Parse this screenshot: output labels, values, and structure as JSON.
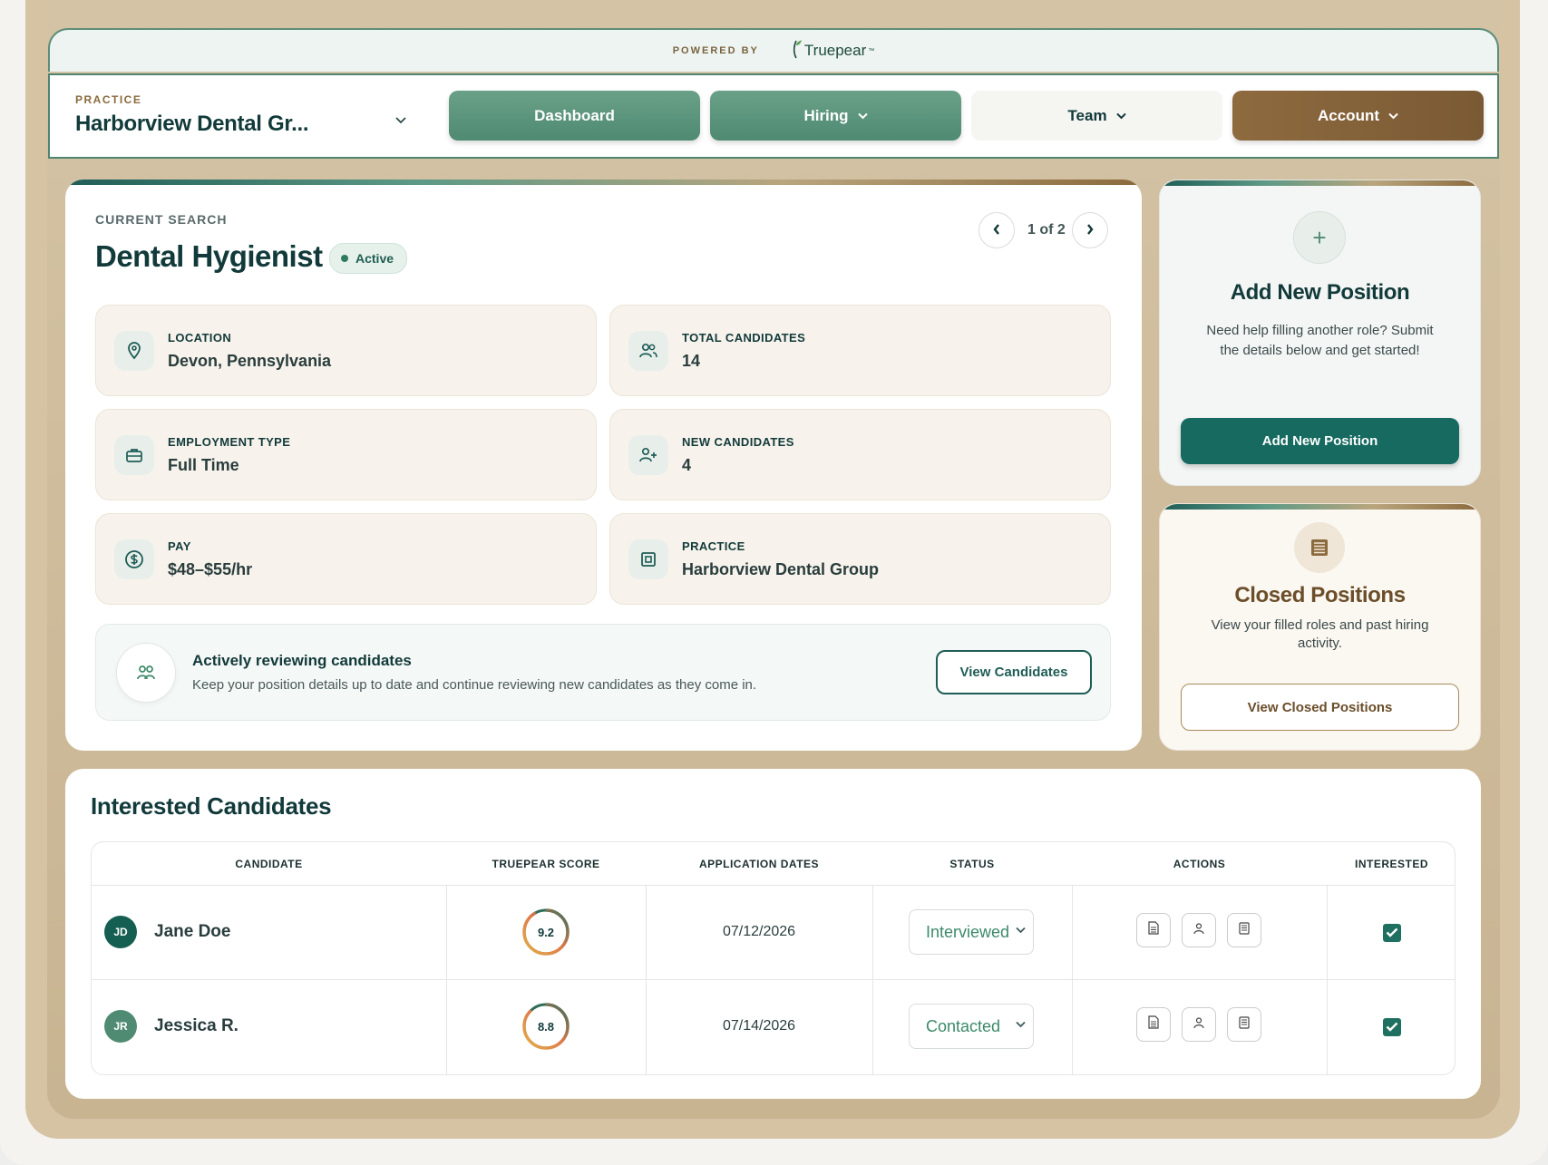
{
  "brand": {
    "powered_by": "POWERED BY",
    "name": "Truepear",
    "tm": "™"
  },
  "nav": {
    "practice_label": "PRACTICE",
    "practice_name": "Harborview Dental Gr...",
    "dashboard": "Dashboard",
    "hiring": "Hiring",
    "team": "Team",
    "account": "Account"
  },
  "search": {
    "label": "CURRENT SEARCH",
    "title": "Dental Hygienist",
    "status": "Active",
    "pager": "1 of 2",
    "tiles": [
      {
        "label": "LOCATION",
        "value": "Devon, Pennsylvania",
        "icon": "map-pin-icon"
      },
      {
        "label": "TOTAL CANDIDATES",
        "value": "14",
        "icon": "users-icon"
      },
      {
        "label": "EMPLOYMENT TYPE",
        "value": "Full Time",
        "icon": "briefcase-icon"
      },
      {
        "label": "NEW CANDIDATES",
        "value": "4",
        "icon": "user-plus-icon"
      },
      {
        "label": "PAY",
        "value": "$48–$55/hr",
        "icon": "dollar-icon"
      },
      {
        "label": "PRACTICE",
        "value": "Harborview Dental Group",
        "icon": "building-icon"
      }
    ],
    "review_title": "Actively reviewing candidates",
    "review_desc": "Keep your position details up to date and continue reviewing new candidates as they come in.",
    "view_candidates": "View Candidates"
  },
  "add_position": {
    "icon": "+",
    "title": "Add New Position",
    "desc": "Need help filling another role? Submit the details below and get started!",
    "button": "Add New Position"
  },
  "closed_positions": {
    "title": "Closed Positions",
    "desc": "View your filled roles and past hiring activity.",
    "button": "View Closed Positions"
  },
  "candidates": {
    "title": "Interested Candidates",
    "columns": [
      "CANDIDATE",
      "TRUEPEAR SCORE",
      "APPLICATION DATES",
      "STATUS",
      "ACTIONS",
      "INTERESTED"
    ],
    "rows": [
      {
        "initials": "JD",
        "name": "Jane Doe",
        "score": "9.2",
        "score_value": 9.2,
        "date": "07/12/2026",
        "status": "Interviewed",
        "interested": true,
        "avatar_color": "#155e52"
      },
      {
        "initials": "JR",
        "name": "Jessica R.",
        "score": "8.8",
        "score_value": 8.8,
        "date": "07/14/2026",
        "status": "Contacted",
        "interested": true,
        "avatar_color": "#4f8a72"
      }
    ]
  }
}
